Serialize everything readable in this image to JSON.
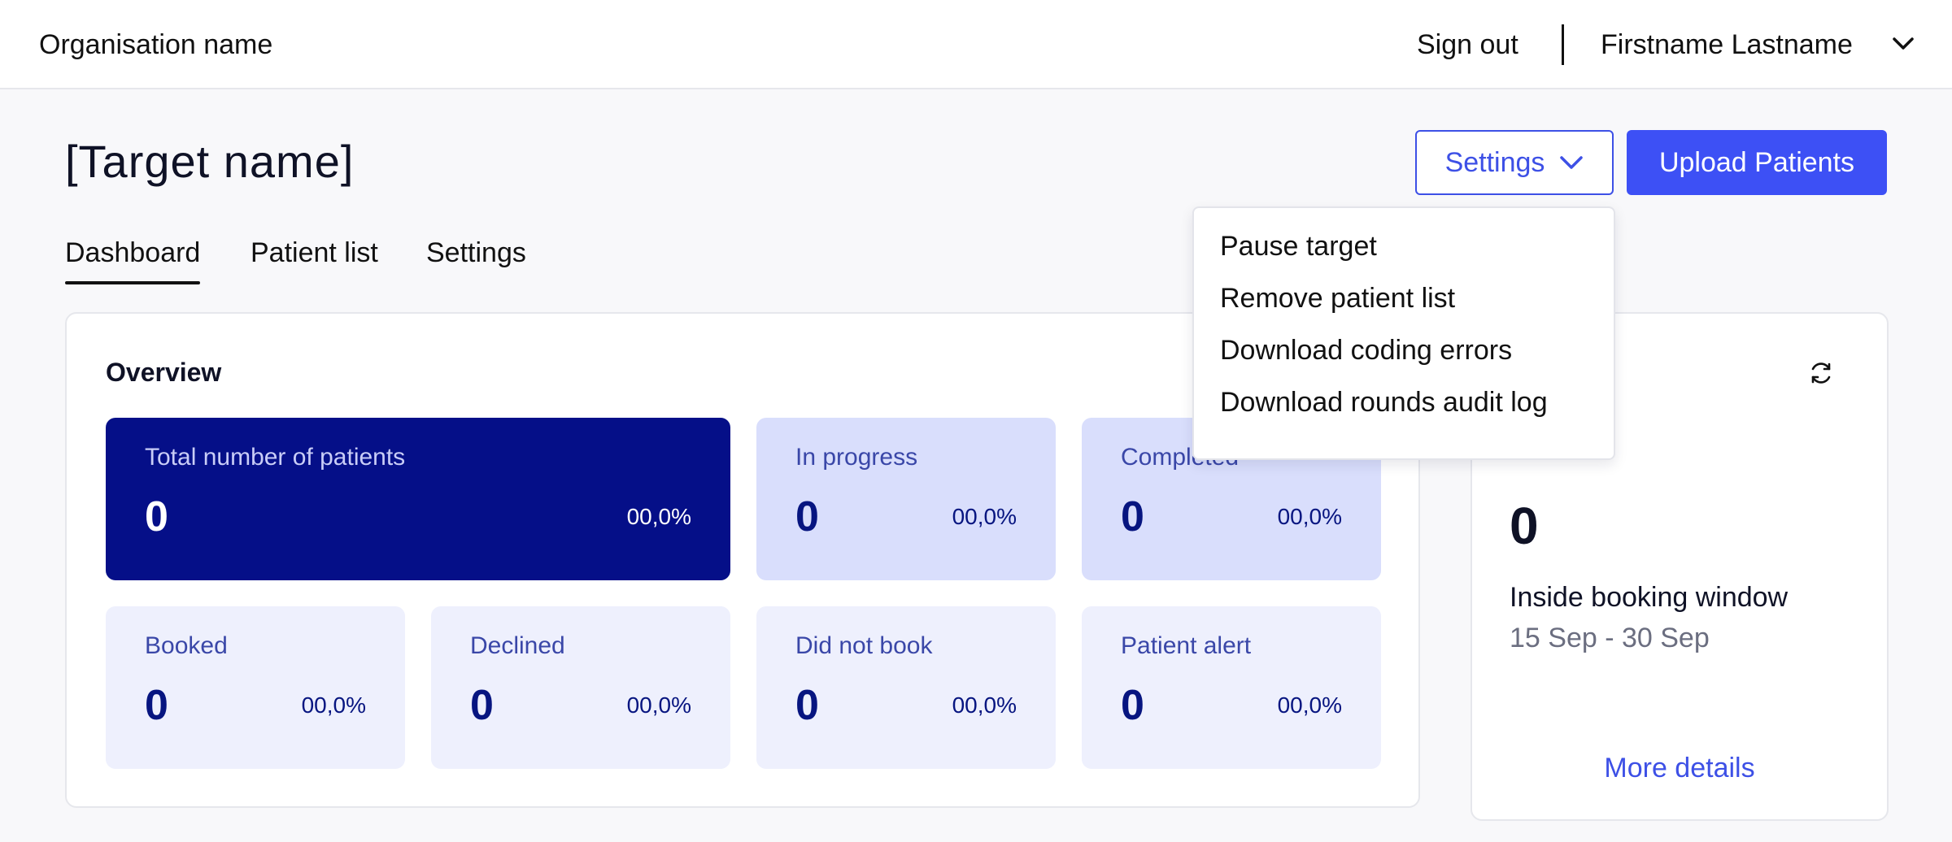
{
  "topbar": {
    "org_name": "Organisation name",
    "sign_out": "Sign out",
    "user_name": "Firstname Lastname"
  },
  "header": {
    "title": "[Target name]",
    "settings_button": "Settings",
    "upload_button": "Upload Patients"
  },
  "tabs": [
    {
      "label": "Dashboard",
      "active": true
    },
    {
      "label": "Patient list",
      "active": false
    },
    {
      "label": "Settings",
      "active": false
    }
  ],
  "overview": {
    "title": "Overview",
    "stats": [
      {
        "label": "Total number of patients",
        "value": "0",
        "percent": "00,0%"
      },
      {
        "label": "In progress",
        "value": "0",
        "percent": "00,0%"
      },
      {
        "label": "Completed",
        "value": "0",
        "percent": "00,0%"
      },
      {
        "label": "Booked",
        "value": "0",
        "percent": "00,0%"
      },
      {
        "label": "Declined",
        "value": "0",
        "percent": "00,0%"
      },
      {
        "label": "Did not book",
        "value": "0",
        "percent": "00,0%"
      },
      {
        "label": "Patient alert",
        "value": "0",
        "percent": "00,0%"
      }
    ]
  },
  "booking": {
    "value": "0",
    "label": "Inside booking window",
    "date_range": "15 Sep - 30 Sep",
    "more_details": "More details"
  },
  "settings_menu": {
    "items": [
      "Pause target",
      "Remove patient list",
      "Download coding errors",
      "Download rounds audit log"
    ]
  },
  "colors": {
    "accent": "#3d50f5",
    "stat_dark": "#050f88",
    "stat_mid": "#d9defc",
    "stat_light": "#eef0fd"
  }
}
